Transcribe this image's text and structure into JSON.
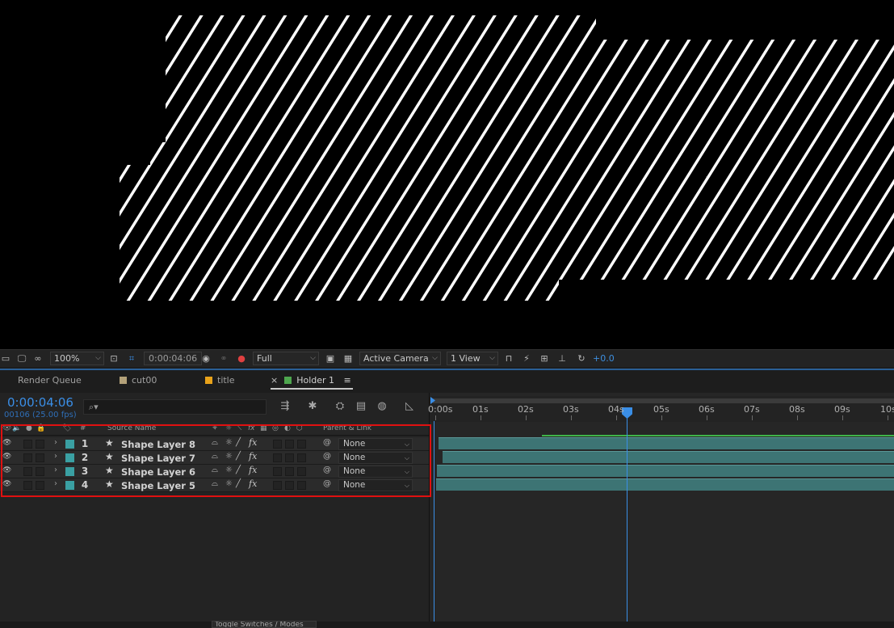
{
  "viewer": {
    "toolbar": {
      "zoom": "100%",
      "timecode": "0:00:04:06",
      "resolution": "Full",
      "camera": "Active Camera",
      "views": "1 View",
      "exposure": "+0.0"
    }
  },
  "tabs": [
    {
      "label": "Render Queue",
      "color": ""
    },
    {
      "label": "cut00",
      "color": "#b3a179"
    },
    {
      "label": "title",
      "color": "#e8a21a"
    },
    {
      "label": "Holder 1",
      "color": "#4ea64e",
      "active": true
    }
  ],
  "timeline": {
    "timecode": "0:00:04:06",
    "frame_info": "00106 (25.00 fps)",
    "search_placeholder": "",
    "columns": {
      "hash": "#",
      "source_name": "Source Name",
      "parent_link": "Parent & Link"
    },
    "layers": [
      {
        "num": "1",
        "name": "Shape Layer 8",
        "parent": "None"
      },
      {
        "num": "2",
        "name": "Shape Layer 7",
        "parent": "None"
      },
      {
        "num": "3",
        "name": "Shape Layer 6",
        "parent": "None"
      },
      {
        "num": "4",
        "name": "Shape Layer 5",
        "parent": "None"
      }
    ],
    "ruler_ticks": [
      "0:00s",
      "01s",
      "02s",
      "03s",
      "04s",
      "05s",
      "06s",
      "07s",
      "08s",
      "09s",
      "10s"
    ],
    "current_time_seconds": 4.24,
    "label_color": "#3aa0a3",
    "bar_color": "#3d7474"
  },
  "bottom": {
    "toggle_label": "Toggle Switches / Modes"
  }
}
